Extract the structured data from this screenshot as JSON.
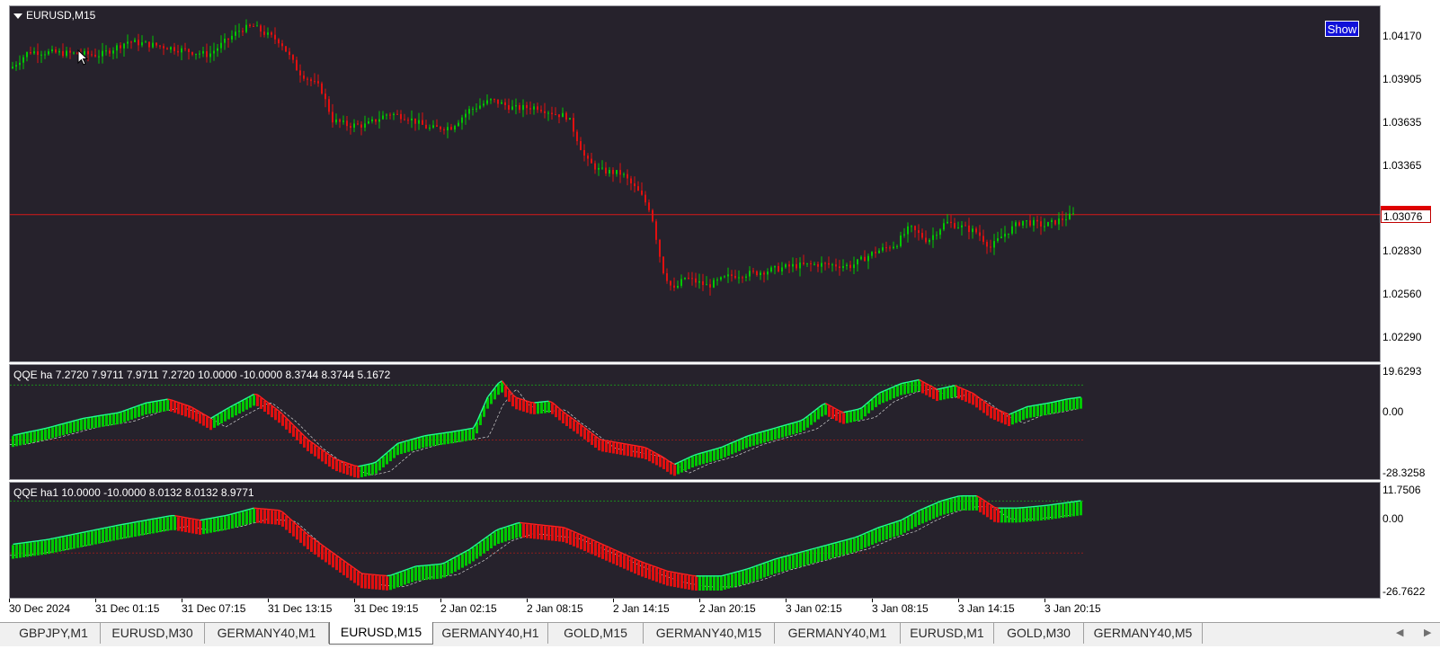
{
  "chart": {
    "symbol_title": "EURUSD,M15",
    "show_button": "Show",
    "current_price": "1.03076",
    "price_ticks": [
      "1.04170",
      "1.03905",
      "1.03635",
      "1.03365",
      "1.02830",
      "1.02560",
      "1.02290"
    ],
    "colors": {
      "background": "#26222c",
      "bull": "#00c800",
      "bear": "#e01010",
      "line_green": "#20ff90",
      "line_red": "#ff2020"
    }
  },
  "indicator1": {
    "title": "QQE ha 7.2720 7.9711 7.9711 7.2720 10.0000 -10.0000 8.3744 8.3744 5.1672",
    "ticks": [
      "19.6293",
      "0.00",
      "-28.3258"
    ]
  },
  "indicator2": {
    "title": "QQE ha1 10.0000 -10.0000 8.0132 8.0132 8.9771",
    "ticks": [
      "11.7506",
      "0.00",
      "-26.7622"
    ]
  },
  "time_axis": [
    "30 Dec 2024",
    "31 Dec 01:15",
    "31 Dec 07:15",
    "31 Dec 13:15",
    "31 Dec 19:15",
    "2 Jan 02:15",
    "2 Jan 08:15",
    "2 Jan 14:15",
    "2 Jan 20:15",
    "3 Jan 02:15",
    "3 Jan 08:15",
    "3 Jan 14:15",
    "3 Jan 20:15"
  ],
  "tabs": [
    "GBPJPY,M1",
    "EURUSD,M30",
    "GERMANY40,M1",
    "EURUSD,M15",
    "GERMANY40,H1",
    "GOLD,M15",
    "GERMANY40,M15",
    "GERMANY40,M1",
    "EURUSD,M1",
    "GOLD,M30",
    "GERMANY40,M5"
  ],
  "active_tab": "EURUSD,M15",
  "price_series": {
    "ylim": [
      1.022,
      1.0432
    ],
    "keypoints": [
      [
        0,
        1.0395
      ],
      [
        20,
        1.0405
      ],
      [
        60,
        1.0404
      ],
      [
        100,
        1.0403
      ],
      [
        130,
        1.0411
      ],
      [
        170,
        1.0408
      ],
      [
        220,
        1.0403
      ],
      [
        255,
        1.0418
      ],
      [
        270,
        1.042
      ],
      [
        285,
        1.0415
      ],
      [
        300,
        1.0411
      ],
      [
        320,
        1.0393
      ],
      [
        345,
        1.0383
      ],
      [
        358,
        1.0364
      ],
      [
        375,
        1.0361
      ],
      [
        395,
        1.0361
      ],
      [
        420,
        1.0368
      ],
      [
        440,
        1.0366
      ],
      [
        465,
        1.0359
      ],
      [
        490,
        1.036
      ],
      [
        510,
        1.037
      ],
      [
        535,
        1.0376
      ],
      [
        560,
        1.0371
      ],
      [
        585,
        1.0372
      ],
      [
        605,
        1.0368
      ],
      [
        620,
        1.0366
      ],
      [
        640,
        1.034
      ],
      [
        655,
        1.0334
      ],
      [
        680,
        1.0332
      ],
      [
        700,
        1.032
      ],
      [
        712,
        1.031
      ],
      [
        725,
        1.0275
      ],
      [
        737,
        1.0262
      ],
      [
        750,
        1.027
      ],
      [
        775,
        1.0265
      ],
      [
        800,
        1.0271
      ],
      [
        830,
        1.0273
      ],
      [
        870,
        1.0277
      ],
      [
        900,
        1.0278
      ],
      [
        935,
        1.0277
      ],
      [
        960,
        1.0285
      ],
      [
        985,
        1.029
      ],
      [
        1000,
        1.03
      ],
      [
        1020,
        1.0292
      ],
      [
        1040,
        1.0303
      ],
      [
        1060,
        1.03
      ],
      [
        1075,
        1.0297
      ],
      [
        1090,
        1.0288
      ],
      [
        1105,
        1.0296
      ],
      [
        1125,
        1.0304
      ],
      [
        1150,
        1.0301
      ],
      [
        1170,
        1.0305
      ],
      [
        1185,
        1.0308
      ]
    ]
  },
  "ind1_series": {
    "ylim": [
      -28.3258,
      19.6293
    ],
    "keypoints": [
      [
        0,
        -12
      ],
      [
        40,
        -8
      ],
      [
        80,
        -3
      ],
      [
        120,
        0
      ],
      [
        150,
        5
      ],
      [
        175,
        7
      ],
      [
        200,
        3
      ],
      [
        222,
        -3
      ],
      [
        240,
        2
      ],
      [
        272,
        10
      ],
      [
        300,
        0
      ],
      [
        330,
        -14
      ],
      [
        360,
        -24
      ],
      [
        385,
        -28
      ],
      [
        405,
        -26
      ],
      [
        430,
        -16
      ],
      [
        460,
        -12
      ],
      [
        490,
        -10
      ],
      [
        515,
        -8
      ],
      [
        530,
        8
      ],
      [
        545,
        17
      ],
      [
        560,
        8
      ],
      [
        580,
        5
      ],
      [
        600,
        6
      ],
      [
        615,
        0
      ],
      [
        630,
        -5
      ],
      [
        655,
        -14
      ],
      [
        680,
        -16
      ],
      [
        705,
        -18
      ],
      [
        725,
        -23
      ],
      [
        737,
        -27
      ],
      [
        760,
        -22
      ],
      [
        790,
        -18
      ],
      [
        820,
        -12
      ],
      [
        850,
        -8
      ],
      [
        880,
        -4
      ],
      [
        905,
        5
      ],
      [
        925,
        0
      ],
      [
        945,
        2
      ],
      [
        965,
        10
      ],
      [
        990,
        15
      ],
      [
        1010,
        17
      ],
      [
        1030,
        12
      ],
      [
        1050,
        14
      ],
      [
        1070,
        10
      ],
      [
        1090,
        3
      ],
      [
        1110,
        -1
      ],
      [
        1130,
        3
      ],
      [
        1155,
        5
      ],
      [
        1175,
        7
      ],
      [
        1190,
        8
      ]
    ]
  },
  "ind2_series": {
    "ylim": [
      -26.7622,
      11.7506
    ],
    "keypoints": [
      [
        0,
        -10
      ],
      [
        40,
        -8
      ],
      [
        80,
        -5
      ],
      [
        120,
        -2
      ],
      [
        150,
        0
      ],
      [
        180,
        2
      ],
      [
        210,
        0
      ],
      [
        240,
        2
      ],
      [
        270,
        5
      ],
      [
        300,
        4
      ],
      [
        330,
        -6
      ],
      [
        360,
        -14
      ],
      [
        390,
        -22
      ],
      [
        420,
        -23
      ],
      [
        450,
        -19
      ],
      [
        480,
        -18
      ],
      [
        510,
        -12
      ],
      [
        540,
        -4
      ],
      [
        565,
        -1
      ],
      [
        590,
        -2
      ],
      [
        615,
        -3
      ],
      [
        640,
        -7
      ],
      [
        670,
        -12
      ],
      [
        700,
        -17
      ],
      [
        730,
        -21
      ],
      [
        760,
        -23
      ],
      [
        790,
        -23
      ],
      [
        820,
        -20
      ],
      [
        850,
        -16
      ],
      [
        880,
        -13
      ],
      [
        910,
        -10
      ],
      [
        940,
        -7
      ],
      [
        965,
        -3
      ],
      [
        990,
        0
      ],
      [
        1010,
        4
      ],
      [
        1035,
        8
      ],
      [
        1055,
        10
      ],
      [
        1075,
        10
      ],
      [
        1095,
        5
      ],
      [
        1120,
        5
      ],
      [
        1150,
        6
      ],
      [
        1190,
        8
      ]
    ]
  }
}
